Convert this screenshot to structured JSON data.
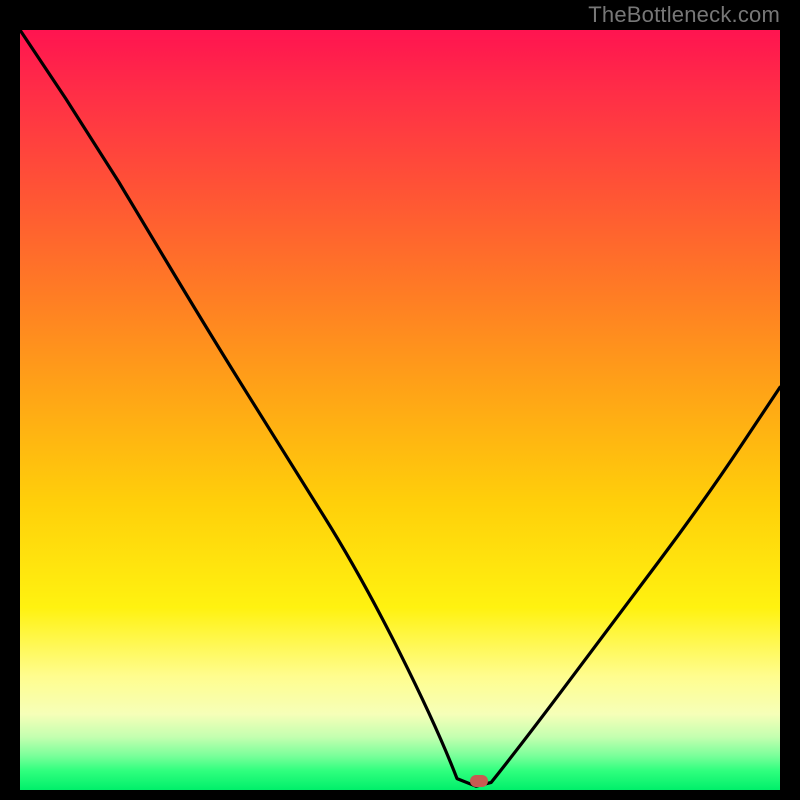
{
  "watermark": "TheBottleneck.com",
  "colors": {
    "background": "#000000",
    "watermark": "#777777",
    "curve": "#000000",
    "marker": "#c75b52",
    "gradient_top": "#ff1450",
    "gradient_bottom": "#00ef6a"
  },
  "chart_data": {
    "type": "line",
    "title": "",
    "xlabel": "",
    "ylabel": "",
    "xlim": [
      0,
      100
    ],
    "ylim": [
      0,
      100
    ],
    "grid": false,
    "series": [
      {
        "name": "bottleneck-curve",
        "x": [
          0,
          6,
          13,
          19,
          25,
          30,
          35,
          40,
          45,
          50,
          55,
          57.5,
          60,
          62,
          66,
          72,
          78,
          84,
          90,
          95,
          100
        ],
        "values": [
          100,
          91,
          80,
          70,
          60,
          52,
          43,
          35,
          27,
          18,
          8,
          1.5,
          0.5,
          1,
          6,
          14,
          22,
          30,
          39,
          46,
          53
        ]
      }
    ],
    "annotations": [
      {
        "name": "optimal-marker",
        "x": 60.4,
        "y": 0.8
      }
    ]
  }
}
